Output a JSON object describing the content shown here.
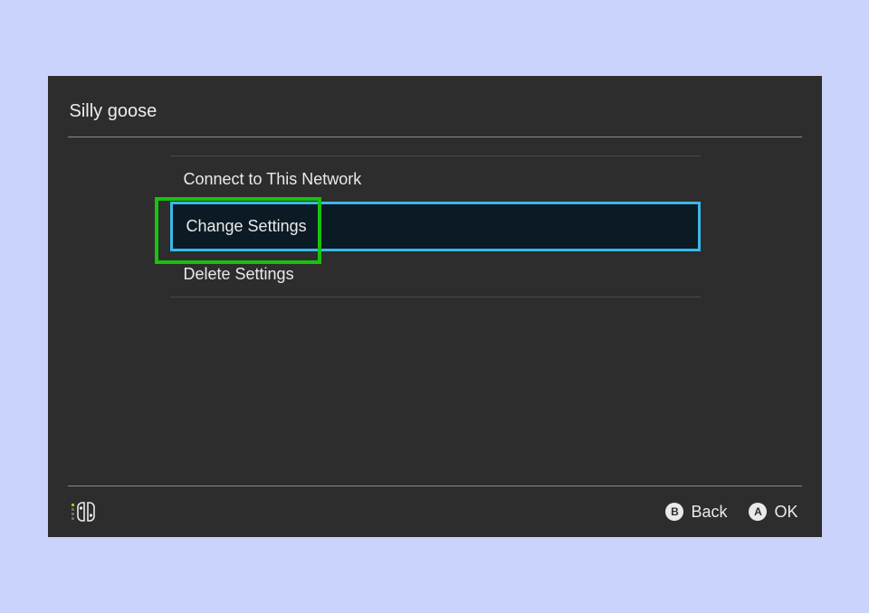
{
  "header": {
    "title": "Silly goose"
  },
  "menu": {
    "items": [
      {
        "label": "Connect to This Network",
        "selected": false
      },
      {
        "label": "Change Settings",
        "selected": true
      },
      {
        "label": "Delete Settings",
        "selected": false
      }
    ]
  },
  "footer": {
    "back": {
      "button_letter": "B",
      "label": "Back"
    },
    "ok": {
      "button_letter": "A",
      "label": "OK"
    }
  },
  "icons": {
    "joycon": "joycon-icon"
  },
  "annotation": {
    "highlight_target": "Change Settings"
  }
}
